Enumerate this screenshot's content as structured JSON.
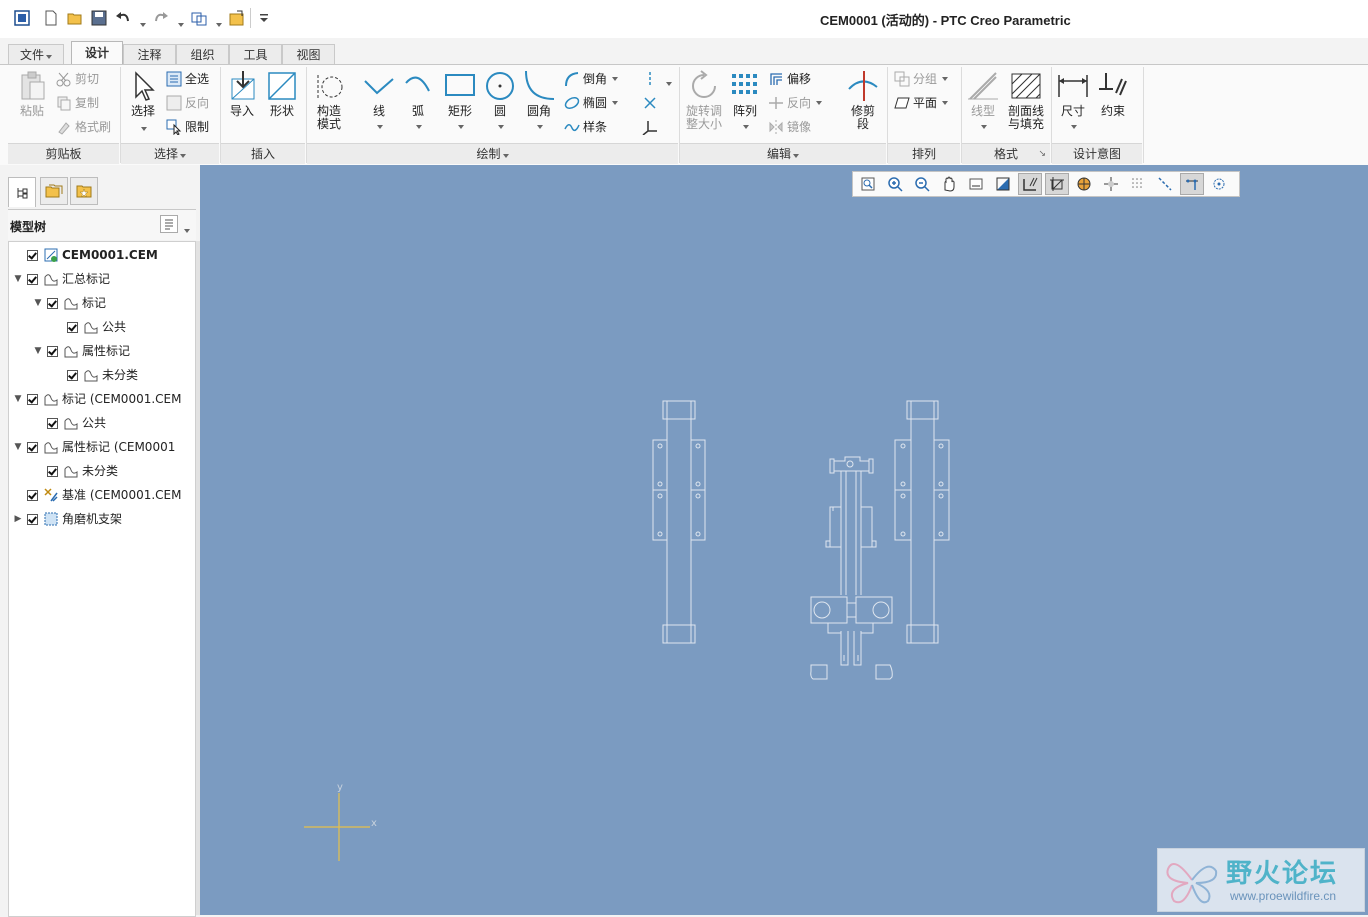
{
  "window": {
    "title": "CEM0001 (活动的) - PTC Creo Parametric"
  },
  "quick_access": {
    "icons": [
      "app-menu-icon",
      "new-file-icon",
      "open-file-icon",
      "save-icon",
      "undo-icon",
      "redo-icon",
      "regenerate-icon",
      "window-icon",
      "customize-icon"
    ]
  },
  "tabs": [
    {
      "label": "文件",
      "dropdown": true
    },
    {
      "label": "设计",
      "active": true
    },
    {
      "label": "注释"
    },
    {
      "label": "组织"
    },
    {
      "label": "工具"
    },
    {
      "label": "视图"
    }
  ],
  "ribbon": {
    "clipboard": {
      "footer": "剪贴板",
      "paste": "粘贴",
      "cut": "剪切",
      "copy": "复制",
      "format_painter": "格式刷"
    },
    "select": {
      "footer": "选择",
      "select": "选择",
      "select_all": "全选",
      "invert": "反向",
      "restrict": "限制"
    },
    "insert": {
      "footer": "插入",
      "import": "导入",
      "shape": "形状"
    },
    "sketch": {
      "footer": "绘制",
      "construction_mode": "构造\n模式",
      "line": "线",
      "arc": "弧",
      "rectangle": "矩形",
      "circle": "圆",
      "fillet": "圆角",
      "chamfer": "倒角",
      "ellipse": "椭圆",
      "spline": "样条"
    },
    "edit": {
      "footer": "编辑",
      "rotate_resize": "旋转调\n整大小",
      "pattern": "阵列",
      "offset": "偏移",
      "reverse": "反向",
      "mirror": "镜像"
    },
    "trim": {
      "label": "修剪\n段"
    },
    "arrange": {
      "footer": "排列",
      "group": "分组",
      "plane": "平面"
    },
    "format": {
      "footer": "格式",
      "linestyle": "线型",
      "hatch_fill": "剖面线\n与填充"
    },
    "design_intent": {
      "footer": "设计意图",
      "dimension": "尺寸",
      "constraint": "约束"
    }
  },
  "model_tree": {
    "title": "模型树",
    "items": [
      {
        "label": "CEM0001.CEM",
        "level": 0,
        "bold": true,
        "expand": ""
      },
      {
        "label": "汇总标记",
        "level": 0,
        "expand": "▼"
      },
      {
        "label": "标记",
        "level": 1,
        "expand": "▼"
      },
      {
        "label": "公共",
        "level": 2,
        "expand": ""
      },
      {
        "label": "属性标记",
        "level": 1,
        "expand": "▼"
      },
      {
        "label": "未分类",
        "level": 2,
        "expand": ""
      },
      {
        "label": "标记 (CEM0001.CEM",
        "level": 0,
        "expand": "▼"
      },
      {
        "label": "公共",
        "level": 1,
        "expand": ""
      },
      {
        "label": "属性标记 (CEM0001",
        "level": 0,
        "expand": "▼"
      },
      {
        "label": "未分类",
        "level": 1,
        "expand": ""
      },
      {
        "label": "基准 (CEM0001.CEM",
        "level": 0,
        "expand": ""
      },
      {
        "label": "角磨机支架",
        "level": 0,
        "expand": "▶"
      }
    ]
  },
  "graphics": {
    "background": "#7b9bc1",
    "axis_labels": {
      "x": "x",
      "y": "y"
    },
    "view_toolbar": [
      "refit-icon",
      "zoom-in-icon",
      "zoom-out-icon",
      "pan-icon",
      "repaint-icon",
      "display-style-icon",
      "sketch-view-icon",
      "datum-display-icon",
      "spin-center-icon",
      "csys-display-icon",
      "grid-icon",
      "axis-display-icon",
      "points-display-icon",
      "annotation-display-icon"
    ]
  },
  "watermark": {
    "name": "野火论坛",
    "url": "www.proewildfire.cn"
  }
}
